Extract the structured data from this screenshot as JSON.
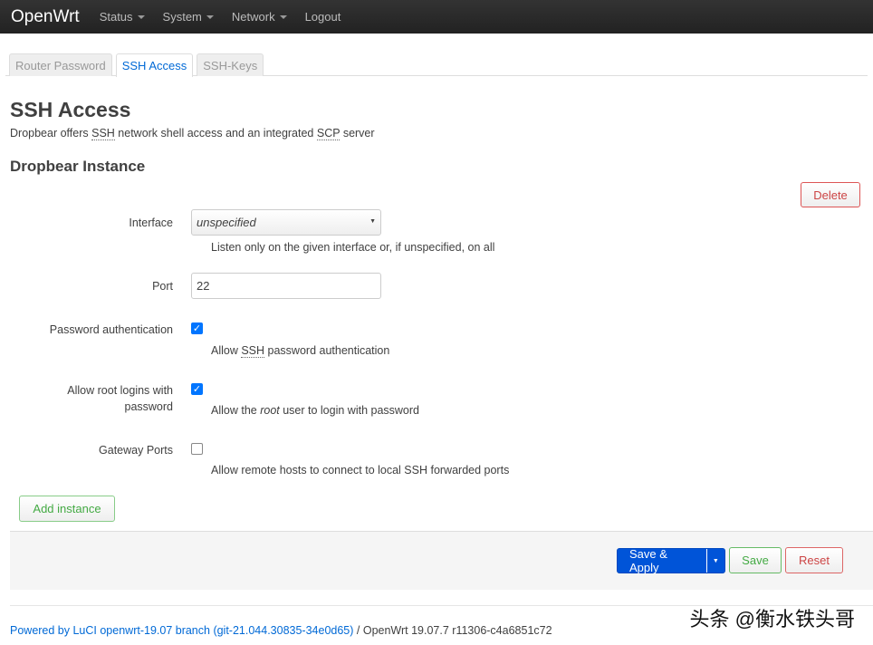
{
  "nav": {
    "brand": "OpenWrt",
    "items": [
      {
        "label": "Status"
      },
      {
        "label": "System"
      },
      {
        "label": "Network"
      }
    ],
    "logout": "Logout"
  },
  "tabs": [
    {
      "label": "Router Password"
    },
    {
      "label": "SSH Access"
    },
    {
      "label": "SSH-Keys"
    }
  ],
  "page": {
    "title": "SSH Access",
    "desc_pre": "Dropbear offers ",
    "ssh": "SSH",
    "desc_mid": " network shell access and an integrated ",
    "scp": "SCP",
    "desc_post": " server"
  },
  "section": {
    "title": "Dropbear Instance",
    "delete": "Delete",
    "interface": {
      "label": "Interface",
      "value": "unspecified",
      "help": "Listen only on the given interface or, if unspecified, on all"
    },
    "port": {
      "label": "Port",
      "value": "22"
    },
    "password_auth": {
      "label": "Password authentication",
      "checked": true,
      "help_pre": "Allow ",
      "help_abbr": "SSH",
      "help_post": " password authentication"
    },
    "root_login": {
      "label1": "Allow root logins with",
      "label2": "password",
      "checked": true,
      "help_pre": "Allow the ",
      "help_em": "root",
      "help_post": " user to login with password"
    },
    "gateway_ports": {
      "label": "Gateway Ports",
      "checked": false,
      "help": "Allow remote hosts to connect to local SSH forwarded ports"
    },
    "add": "Add instance"
  },
  "actions": {
    "save_apply": "Save & Apply",
    "save": "Save",
    "reset": "Reset"
  },
  "footer": {
    "link": "Powered by LuCI openwrt-19.07 branch (git-21.044.30835-34e0d65)",
    "rest": " / OpenWrt 19.07.7 r11306-c4a6851c72"
  },
  "watermark": "头条 @衡水铁头哥",
  "colors": {
    "accent": "#0069d6",
    "primary": "#0054d8",
    "danger": "#c44",
    "success": "#4a4"
  }
}
